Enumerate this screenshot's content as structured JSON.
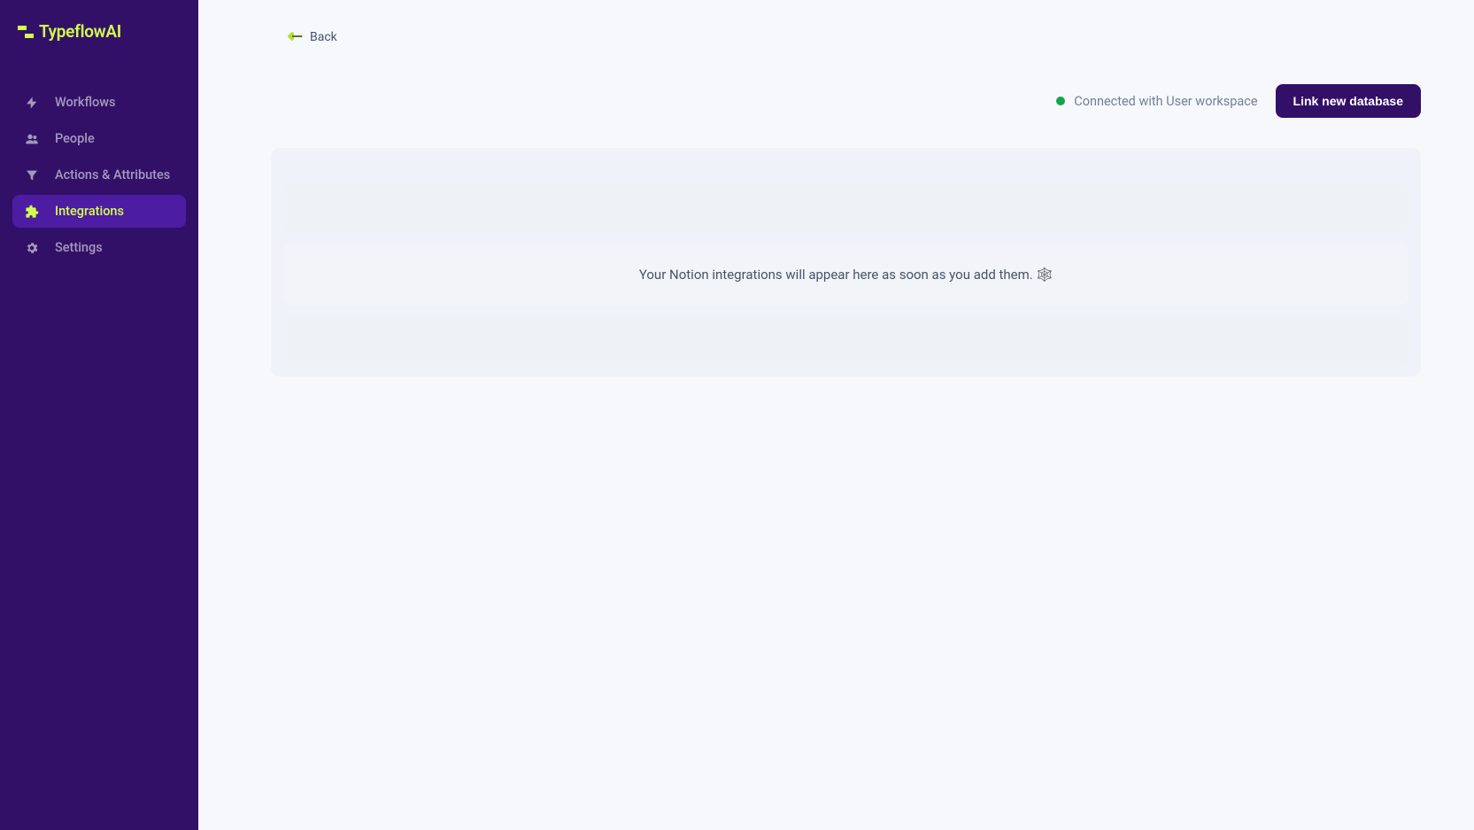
{
  "logo": {
    "text": "TypeflowAI"
  },
  "sidebar": {
    "items": [
      {
        "label": "Workflows",
        "icon": "bolt-icon",
        "active": false
      },
      {
        "label": "People",
        "icon": "people-icon",
        "active": false
      },
      {
        "label": "Actions & Attributes",
        "icon": "funnel-icon",
        "active": false
      },
      {
        "label": "Integrations",
        "icon": "puzzle-icon",
        "active": true
      },
      {
        "label": "Settings",
        "icon": "gear-icon",
        "active": false
      }
    ]
  },
  "back": {
    "label": "Back"
  },
  "status": {
    "text": "Connected with User workspace"
  },
  "actions": {
    "link_db": "Link new database"
  },
  "empty_message": "Your Notion integrations will appear here as soon as you add them. 🕸️"
}
